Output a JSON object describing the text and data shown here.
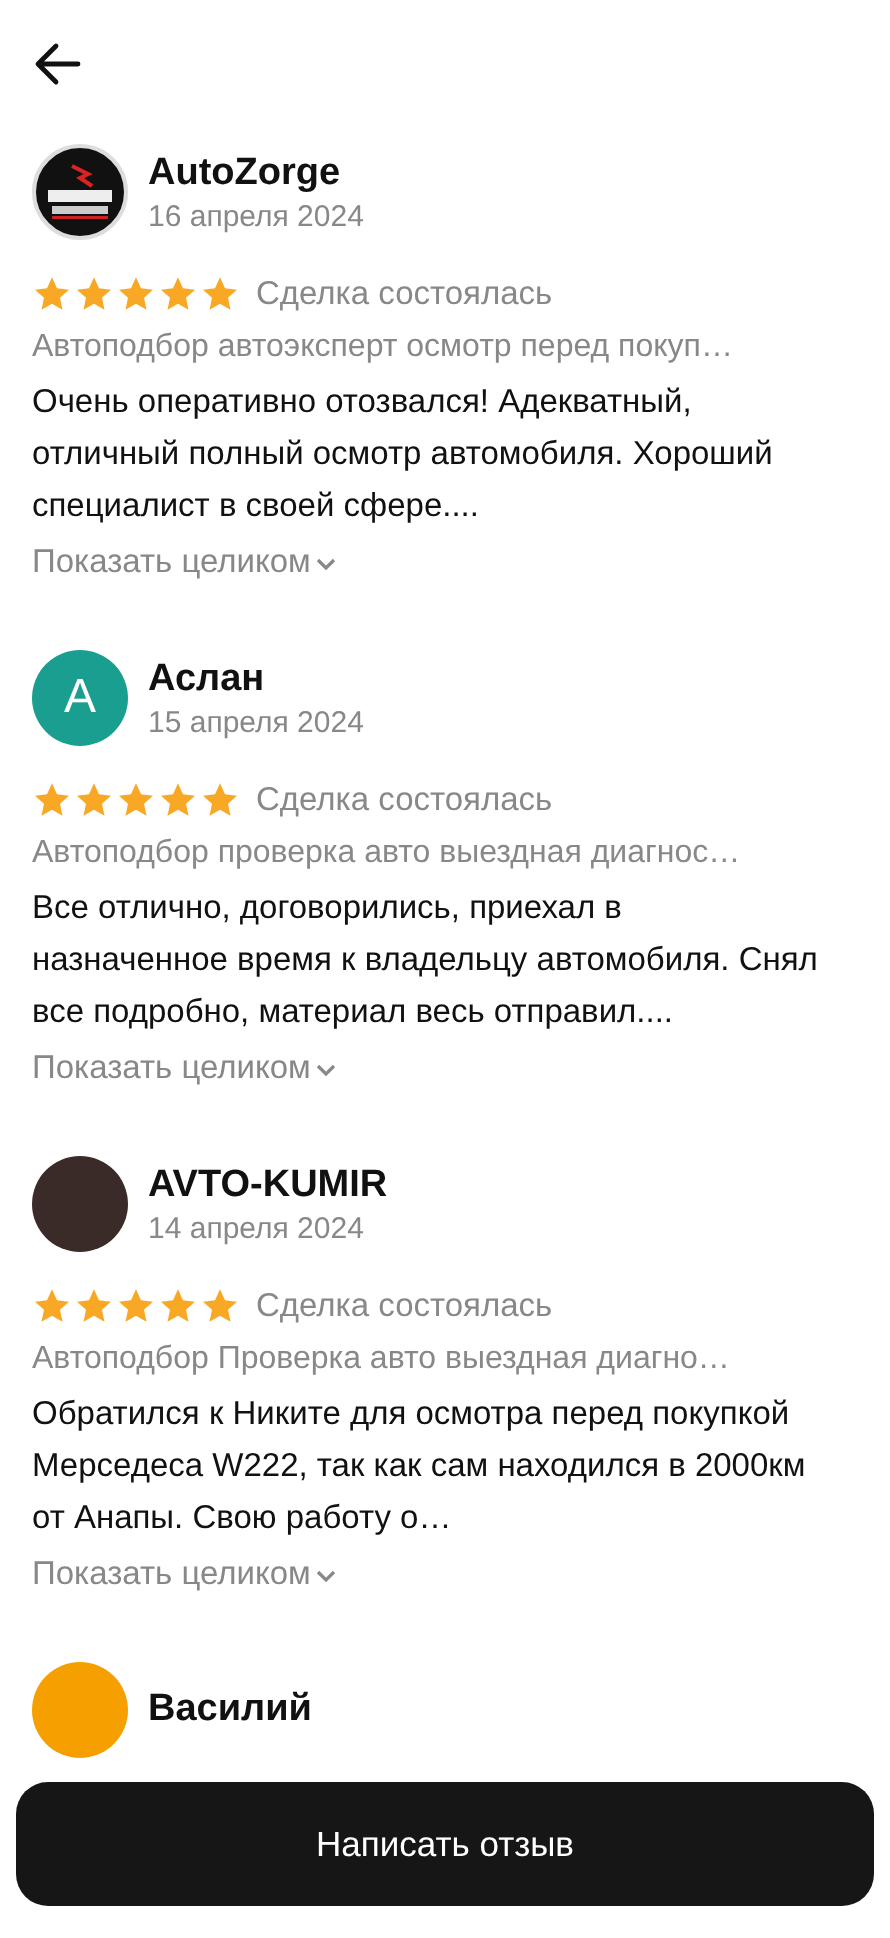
{
  "reviews": [
    {
      "author": "AutoZorge",
      "date": "16 апреля 2024",
      "avatar": {
        "kind": "logo"
      },
      "stars": 5,
      "status": "Сделка состоялась",
      "service": "Автоподбор автоэксперт осмотр перед покуп…",
      "text": "Очень оперативно отозвался! Адекватный, отличный полный осмотр автомобиля. Хороший специалист в своей сфере....",
      "more": "Показать целиком"
    },
    {
      "author": "Аслан",
      "date": "15 апреля 2024",
      "avatar": {
        "kind": "letter",
        "letter": "А",
        "color": "#1a9e8f"
      },
      "stars": 5,
      "status": "Сделка состоялась",
      "service": "Автоподбор проверка авто выездная диагнос…",
      "text": "Все отлично, договорились, приехал в назначенное время к владельцу автомобиля. Снял все подробно, материал весь отправил....",
      "more": "Показать целиком"
    },
    {
      "author": "AVTO-KUMIR",
      "date": "14 апреля 2024",
      "avatar": {
        "kind": "photo"
      },
      "stars": 5,
      "status": "Сделка состоялась",
      "service": "Автоподбор Проверка авто выездная диагно…",
      "text": "Обратился к Никите для осмотра перед покупкой Мерседеса W222, так как сам находился в 2000км от Анапы. Свою работу о…",
      "more": "Показать целиком"
    },
    {
      "author": "Василий",
      "avatar": {
        "kind": "letter",
        "color": "#f5a000"
      }
    }
  ],
  "action_button": "Написать отзыв"
}
